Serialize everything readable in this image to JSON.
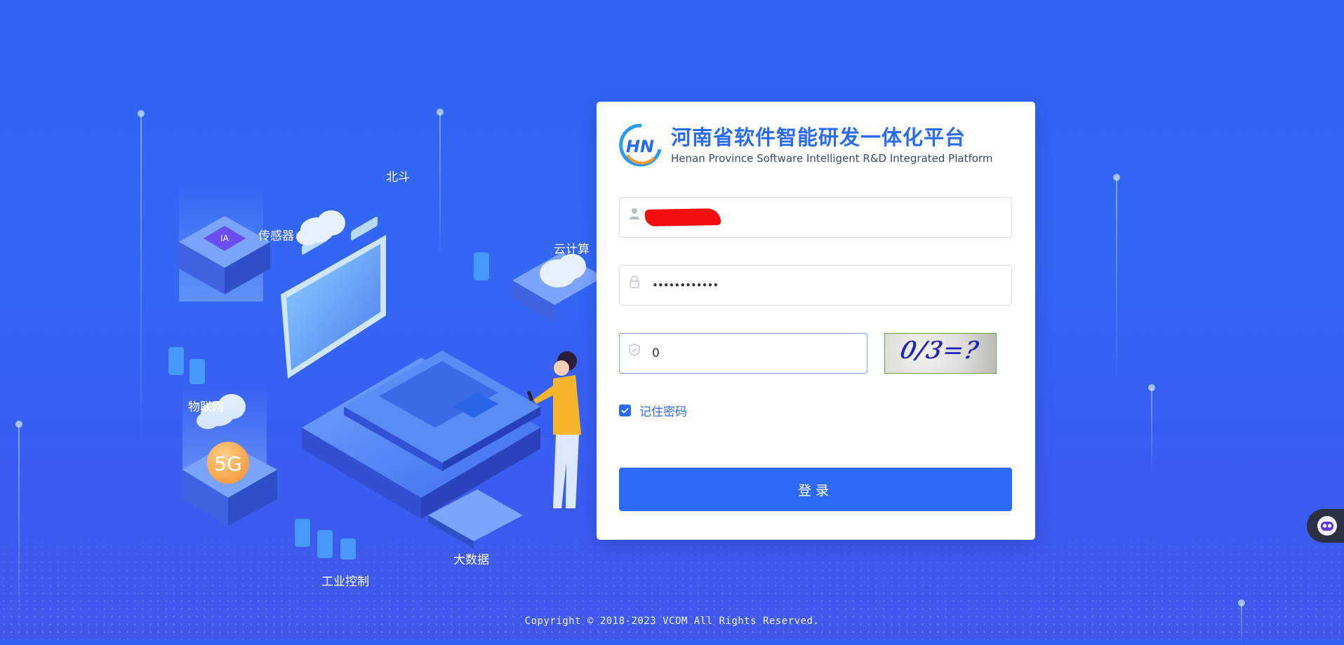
{
  "branding": {
    "title_cn": "河南省软件智能研发一体化平台",
    "title_en": "Henan Province Software Intelligent R&D Integrated Platform",
    "logo_icon": "hn-logo-icon"
  },
  "illustration": {
    "labels": {
      "beidou": "北斗",
      "sensor": "传感器",
      "cloud": "云计算",
      "iot": "物联网",
      "fiveg": "5G",
      "industrial": "工业控制",
      "bigdata": "大数据"
    }
  },
  "login": {
    "username": {
      "icon": "user-icon",
      "value": ""
    },
    "password": {
      "icon": "lock-icon",
      "value": "••••••••••••"
    },
    "captcha": {
      "icon": "shield-icon",
      "value": "0",
      "image_text": "0/3=?"
    },
    "remember": {
      "label": "记住密码",
      "checked": true
    },
    "submit_label": "登录"
  },
  "footer": {
    "copyright": "Copyright © 2018-2023 VCOM All Rights Reserved."
  },
  "floating_assistant": {
    "icon": "robot-face-icon"
  },
  "colors": {
    "primary": "#2d6af6",
    "background": "#3366f3"
  }
}
